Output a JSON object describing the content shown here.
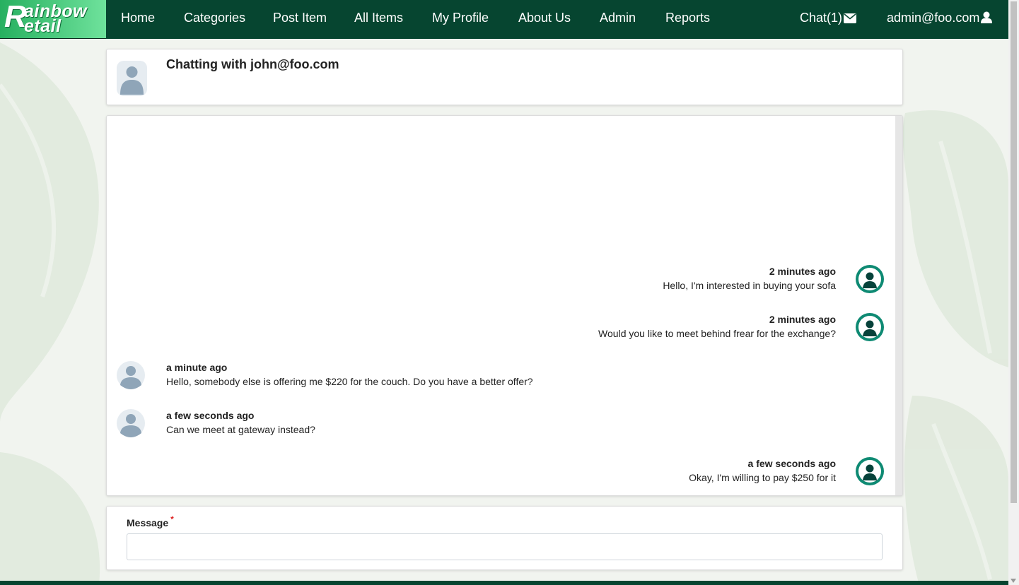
{
  "brand": {
    "logo_text": "Rainbow Retail"
  },
  "nav": {
    "items": [
      "Home",
      "Categories",
      "Post Item",
      "All Items",
      "My Profile",
      "About Us",
      "Admin",
      "Reports"
    ],
    "chat_label": "Chat(1)",
    "user_label": "admin@foo.com"
  },
  "chat": {
    "title": "Chatting with john@foo.com",
    "messages": [
      {
        "time": "2 minutes ago",
        "text": "Hello, I'm interested in buying your sofa",
        "side": "right"
      },
      {
        "time": "2 minutes ago",
        "text": "Would you like to meet behind frear for the exchange?",
        "side": "right"
      },
      {
        "time": "a minute ago",
        "text": "Hello, somebody else is offering me $220 for the couch. Do you have a better offer?",
        "side": "left"
      },
      {
        "time": "a few seconds ago",
        "text": "Can we meet at gateway instead?",
        "side": "left"
      },
      {
        "time": "a few seconds ago",
        "text": "Okay, I'm willing to pay $250 for it",
        "side": "right"
      }
    ]
  },
  "form": {
    "message_label": "Message",
    "required_mark": "*",
    "message_value": ""
  },
  "colors": {
    "navbar": "#064530",
    "self_avatar": "#0e8a73",
    "other_avatar": "#8fa5b8"
  }
}
